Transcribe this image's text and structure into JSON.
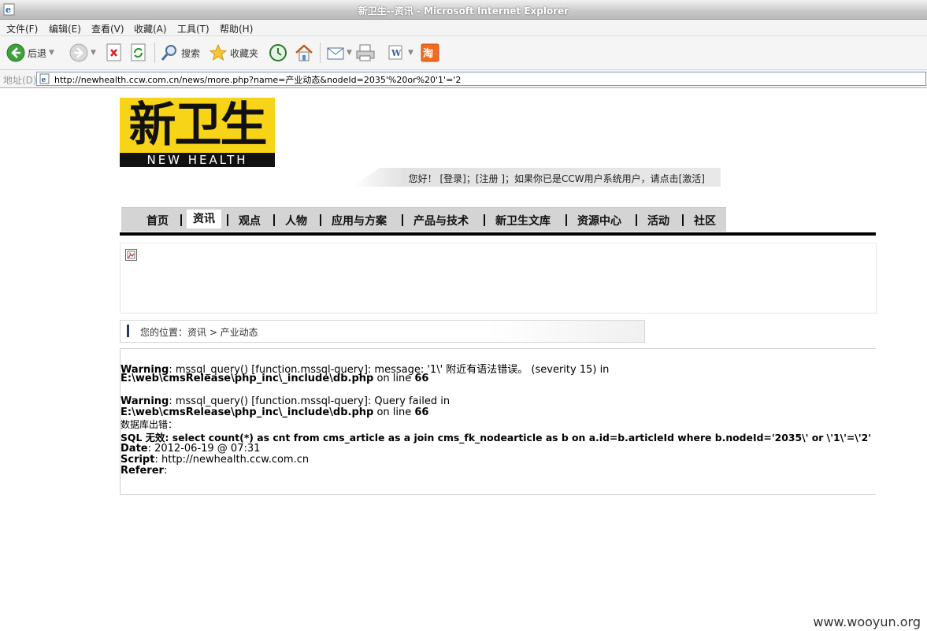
{
  "window": {
    "title": "新卫生--资讯 - Microsoft Internet Explorer"
  },
  "menu": [
    "文件(F)",
    "编辑(E)",
    "查看(V)",
    "收藏(A)",
    "工具(T)",
    "帮助(H)"
  ],
  "toolbar": {
    "back": "后退",
    "search": "搜索",
    "favorites": "收藏夹"
  },
  "address": {
    "label": "地址(D)",
    "url": "http://newhealth.ccw.com.cn/news/more.php?name=产业动态&nodeId=2035'%20or%20'1'='2"
  },
  "logo": {
    "cn": "新卫生",
    "en": "NEW HEALTH"
  },
  "login_text": "您好！ [登录]；[注册 ]；如果你已是CCW用户系统用户，请点击[激活]",
  "nav": [
    {
      "label": "首页"
    },
    {
      "label": "资讯",
      "active": true
    },
    {
      "label": "观点"
    },
    {
      "label": "人物"
    },
    {
      "label": "应用与方案"
    },
    {
      "label": "产品与技术"
    },
    {
      "label": "新卫生文库"
    },
    {
      "label": "资源中心"
    },
    {
      "label": "活动"
    },
    {
      "label": "社区"
    }
  ],
  "breadcrumb": "您的位置：资讯  > 产业动态",
  "errors": {
    "w1_label": "Warning",
    "w1_msg": ": mssql_query() [function.mssql-query]: message: '1\\' 附近有语法错误。 (severity 15) in",
    "w1_file": "E:\\web\\cmsRelease\\php_inc\\_include\\db.php",
    "on_line": " on line ",
    "line": "66",
    "w2_label": "Warning",
    "w2_msg": ": mssql_query() [function.mssql-query]: Query failed in",
    "w2_file": "E:\\web\\cmsRelease\\php_inc\\_include\\db.php",
    "db_error": "数据库出错：",
    "sql": "SQL 无效: select count(*) as cnt from  cms_article as a join  cms_fk_nodearticle as b on a.id=b.articleId  where  b.nodeId='2035\\' or \\'1\\'=\\'2'",
    "date_label": "Date",
    "date": ": 2012-06-19 @ 07:31",
    "script_label": "Script",
    "script": ": http://newhealth.ccw.com.cn",
    "referer_label": "Referer",
    "referer": ":"
  },
  "watermark": "www.wooyun.org"
}
